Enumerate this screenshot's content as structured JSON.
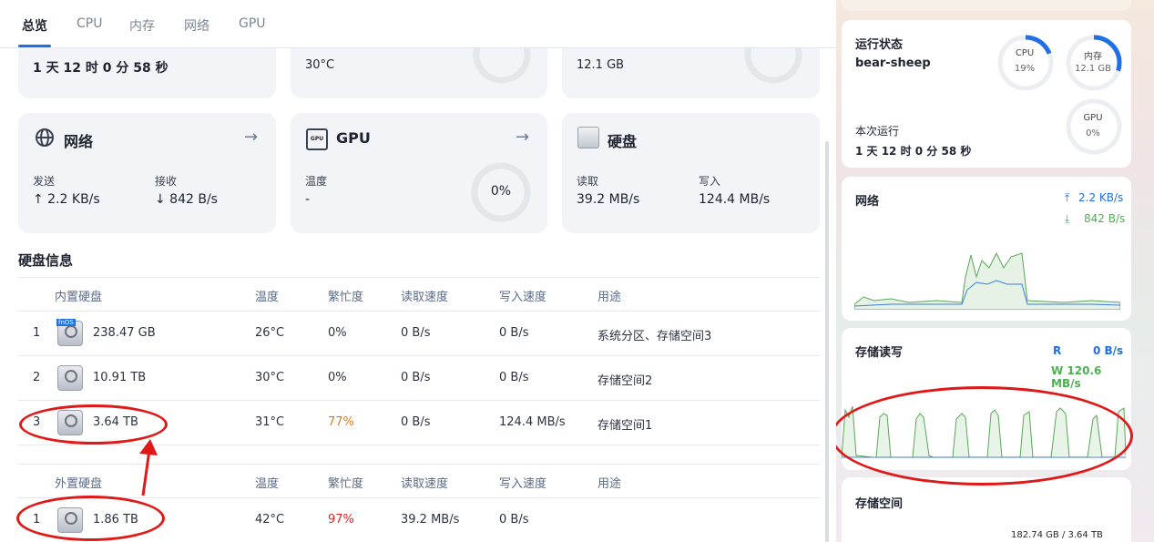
{
  "tabs": [
    "总览",
    "CPU",
    "内存",
    "网络",
    "GPU"
  ],
  "top_cards_partial": [
    "1 天 12 时 0 分 58 秒",
    "30°C",
    "12.1 GB"
  ],
  "cards": {
    "network": {
      "title": "网络",
      "send_label": "发送",
      "send_value": "↑ 2.2 KB/s",
      "recv_label": "接收",
      "recv_value": "↓ 842 B/s"
    },
    "gpu": {
      "title": "GPU",
      "temp_label": "温度",
      "temp_value": "-",
      "usage": "0%"
    },
    "disk": {
      "title": "硬盘",
      "read_label": "读取",
      "read_value": "39.2 MB/s",
      "write_label": "写入",
      "write_value": "124.4 MB/s"
    }
  },
  "disk_info": {
    "title": "硬盘信息",
    "internal_header": [
      "内置硬盘",
      "温度",
      "繁忙度",
      "读取速度",
      "写入速度",
      "用途"
    ],
    "internal_rows": [
      {
        "idx": "1",
        "size": "238.47 GB",
        "temp": "26°C",
        "busy": "0%",
        "read": "0 B/s",
        "write": "0 B/s",
        "use": "系统分区、存储空间3",
        "badge": "fnOS"
      },
      {
        "idx": "2",
        "size": "10.91 TB",
        "temp": "30°C",
        "busy": "0%",
        "read": "0 B/s",
        "write": "0 B/s",
        "use": "存储空间2"
      },
      {
        "idx": "3",
        "size": "3.64 TB",
        "temp": "31°C",
        "busy": "77%",
        "read": "0 B/s",
        "write": "124.4 MB/s",
        "use": "存储空间1"
      }
    ],
    "external_header": [
      "外置硬盘",
      "温度",
      "繁忙度",
      "读取速度",
      "写入速度",
      "用途"
    ],
    "external_rows": [
      {
        "idx": "1",
        "size": "1.86 TB",
        "temp": "42°C",
        "busy": "97%",
        "read": "39.2 MB/s",
        "write": "0 B/s",
        "use": ""
      }
    ]
  },
  "sidebar": {
    "status_title": "运行状态",
    "hostname": "bear-sheep",
    "cpu_label": "CPU",
    "cpu_value": "19%",
    "cpu_fraction": 0.19,
    "mem_label": "内存",
    "mem_value": "12.1 GB",
    "mem_fraction": 0.3,
    "gpu_label": "GPU",
    "gpu_value": "0%",
    "gpu_fraction": 0,
    "uptime_label": "本次运行",
    "uptime_value": "1 天 12 时 0 分 58 秒",
    "net_title": "网络",
    "net_up": "2.2 KB/s",
    "net_down": "842 B/s",
    "io_title": "存储读写",
    "io_r_label": "R",
    "io_r_value": "0 B/s",
    "io_w_value": "W 120.6 MB/s",
    "space_title": "存储空间",
    "space_value": "182.74 GB / 3.64 TB"
  },
  "colors": {
    "accent": "#1f6fe5",
    "warning": "#e07a1f",
    "danger": "#e02424",
    "green": "#4caf50",
    "annotation": "#e01818"
  }
}
